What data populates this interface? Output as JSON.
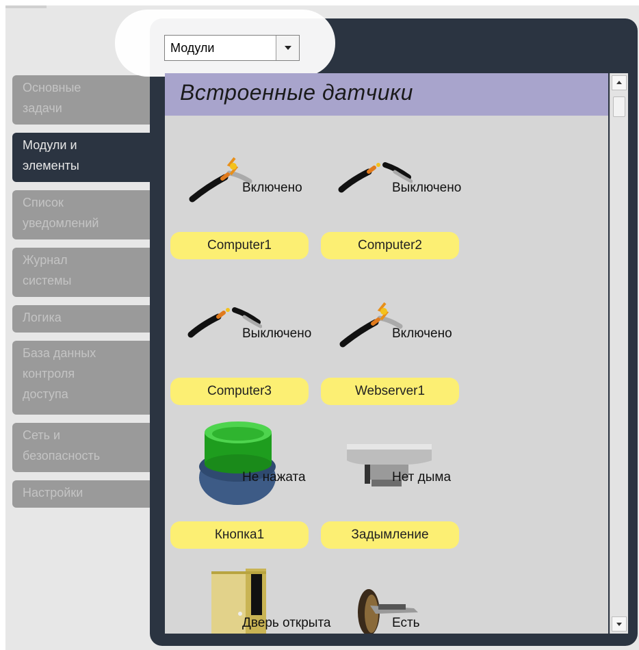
{
  "nav": {
    "items": [
      {
        "label_l1": "Основные",
        "label_l2": "задачи"
      },
      {
        "label_l1": "Модули и",
        "label_l2": "элементы"
      },
      {
        "label_l1": "Список",
        "label_l2": "уведомлений"
      },
      {
        "label_l1": "Журнал",
        "label_l2": "системы"
      },
      {
        "label_l1": "Логика"
      },
      {
        "label_l1": "База данных",
        "label_l2": "контроля",
        "label_l3": "доступа"
      },
      {
        "label_l1": "Сеть и",
        "label_l2": "безопасность"
      },
      {
        "label_l1": "Настройки"
      }
    ],
    "active_index": 1
  },
  "filter": {
    "selected": "Модули"
  },
  "section": {
    "title": "Встроенные датчики"
  },
  "devices": [
    {
      "name": "Computer1",
      "state": "Включено",
      "icon": "plug-connected-spark-icon"
    },
    {
      "name": "Computer2",
      "state": "Выключено",
      "icon": "plug-disconnected-icon"
    },
    {
      "name": "Computer3",
      "state": "Выключено",
      "icon": "plug-disconnected-icon"
    },
    {
      "name": "Webserver1",
      "state": "Включено",
      "icon": "plug-connected-spark-icon"
    },
    {
      "name": "Кнопка1",
      "state": "Не нажата",
      "icon": "green-push-button-icon"
    },
    {
      "name": "Задымление",
      "state": "Нет дыма",
      "icon": "smoke-detector-icon"
    },
    {
      "name": "",
      "state": "Дверь открыта",
      "icon": "open-door-icon"
    },
    {
      "name": "",
      "state": "Есть",
      "icon": "card-reader-icon"
    }
  ],
  "colors": {
    "panel": "#2b3441",
    "nav_inactive": "#9a9a9a",
    "heading_bg": "#a8a4cc",
    "label_pill": "#fcef73",
    "content_bg": "#d6d6d6"
  }
}
